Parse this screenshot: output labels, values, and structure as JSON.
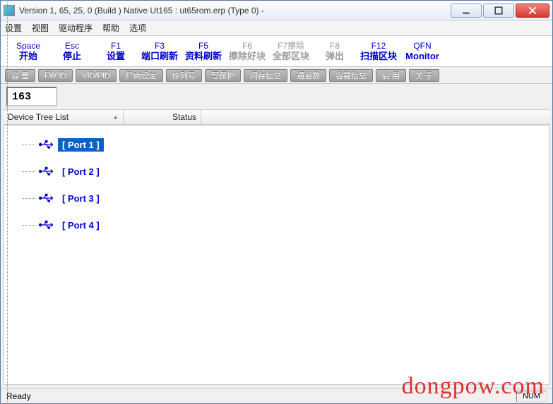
{
  "window": {
    "title": "Version 1, 65, 25, 0 (Build )  Native Ut165 : ut65rom.erp  (Type 0)  -"
  },
  "menu": {
    "items": [
      "设置",
      "视图",
      "驱动程序",
      "帮助",
      "选项"
    ]
  },
  "fkeys": [
    {
      "key": "Space",
      "label": "开始",
      "enabled": true
    },
    {
      "key": "Esc",
      "label": "停止",
      "enabled": true
    },
    {
      "key": "F1",
      "label": "设置",
      "enabled": true
    },
    {
      "key": "F3",
      "label": "端口刷新",
      "enabled": true
    },
    {
      "key": "F5",
      "label": "资料刷新",
      "enabled": true
    },
    {
      "key": "F6",
      "label": "擦除好块",
      "enabled": false
    },
    {
      "key": "F7擦除",
      "label": "全部区块",
      "enabled": false
    },
    {
      "key": "F8",
      "label": "弹出",
      "enabled": false
    },
    {
      "key": "F12",
      "label": "扫描区块",
      "enabled": true
    },
    {
      "key": "QFN",
      "label": "Monitor",
      "enabled": true
    }
  ],
  "toolbar": {
    "buttons": [
      "容 量",
      "FW ID",
      "VID/PID",
      "厂商设定",
      "序列号",
      "写保护",
      "闪存信息",
      "通道数",
      "容载信息",
      "启 用",
      "关 于"
    ]
  },
  "counter": "163",
  "columns": {
    "c1": "Device Tree List",
    "c2": "Status"
  },
  "ports": [
    {
      "label": "[ Port  1 ]",
      "selected": true
    },
    {
      "label": "[ Port  2 ]",
      "selected": false
    },
    {
      "label": "[ Port  3 ]",
      "selected": false
    },
    {
      "label": "[ Port  4 ]",
      "selected": false
    }
  ],
  "status": {
    "ready": "Ready",
    "num": "NUM"
  },
  "watermark": "dongpow.com"
}
